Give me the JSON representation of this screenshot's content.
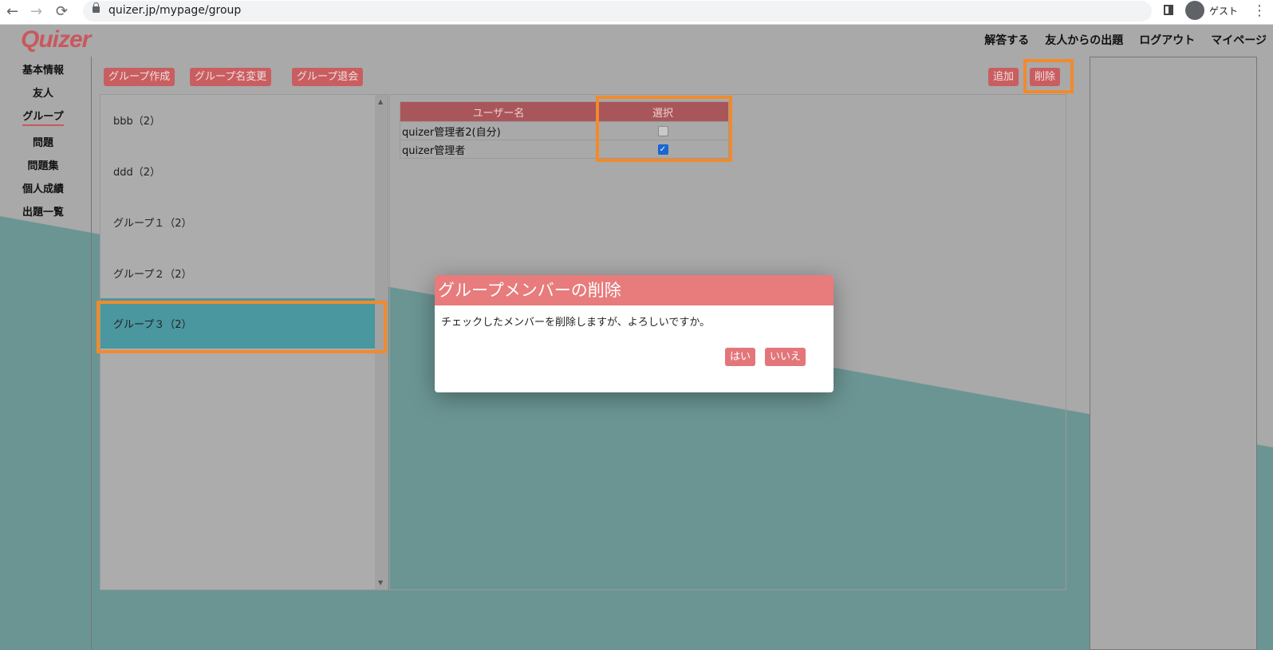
{
  "browser": {
    "url": "quizer.jp/mypage/group",
    "profile_label": "ゲスト",
    "back_icon": "←",
    "forward_icon": "→",
    "reload_icon": "⟳",
    "menu_icon": "⋮"
  },
  "app": {
    "logo": "Quizer",
    "topnav": [
      "解答する",
      "友人からの出題",
      "ログアウト",
      "マイページ"
    ]
  },
  "sidebar": {
    "items": [
      {
        "label": "基本情報",
        "active": false
      },
      {
        "label": "友人",
        "active": false
      },
      {
        "label": "グループ",
        "active": true
      },
      {
        "label": "問題",
        "active": false
      },
      {
        "label": "問題集",
        "active": false
      },
      {
        "label": "個人成績",
        "active": false
      },
      {
        "label": "出題一覧",
        "active": false
      }
    ]
  },
  "toolbar": {
    "create": "グループ作成",
    "rename": "グループ名変更",
    "leave": "グループ退会",
    "add": "追加",
    "delete": "削除"
  },
  "groups": [
    {
      "label": "bbb（2）",
      "selected": false
    },
    {
      "label": "ddd（2）",
      "selected": false
    },
    {
      "label": "グループ１（2）",
      "selected": false
    },
    {
      "label": "グループ２（2）",
      "selected": false
    },
    {
      "label": "グループ３（2）",
      "selected": true
    }
  ],
  "members": {
    "headers": {
      "name": "ユーザー名",
      "select": "選択"
    },
    "rows": [
      {
        "name": "quizer管理者2(自分)",
        "checked": false
      },
      {
        "name": "quizer管理者",
        "checked": true
      }
    ]
  },
  "dialog": {
    "title": "グループメンバーの削除",
    "message": "チェックしたメンバーを削除しますが、よろしいですか。",
    "yes": "はい",
    "no": "いいえ"
  },
  "colors": {
    "accent": "#c95e61",
    "highlight": "#f28a2c",
    "selected_group": "#4a979f",
    "dialog_header": "#e87b7c"
  }
}
